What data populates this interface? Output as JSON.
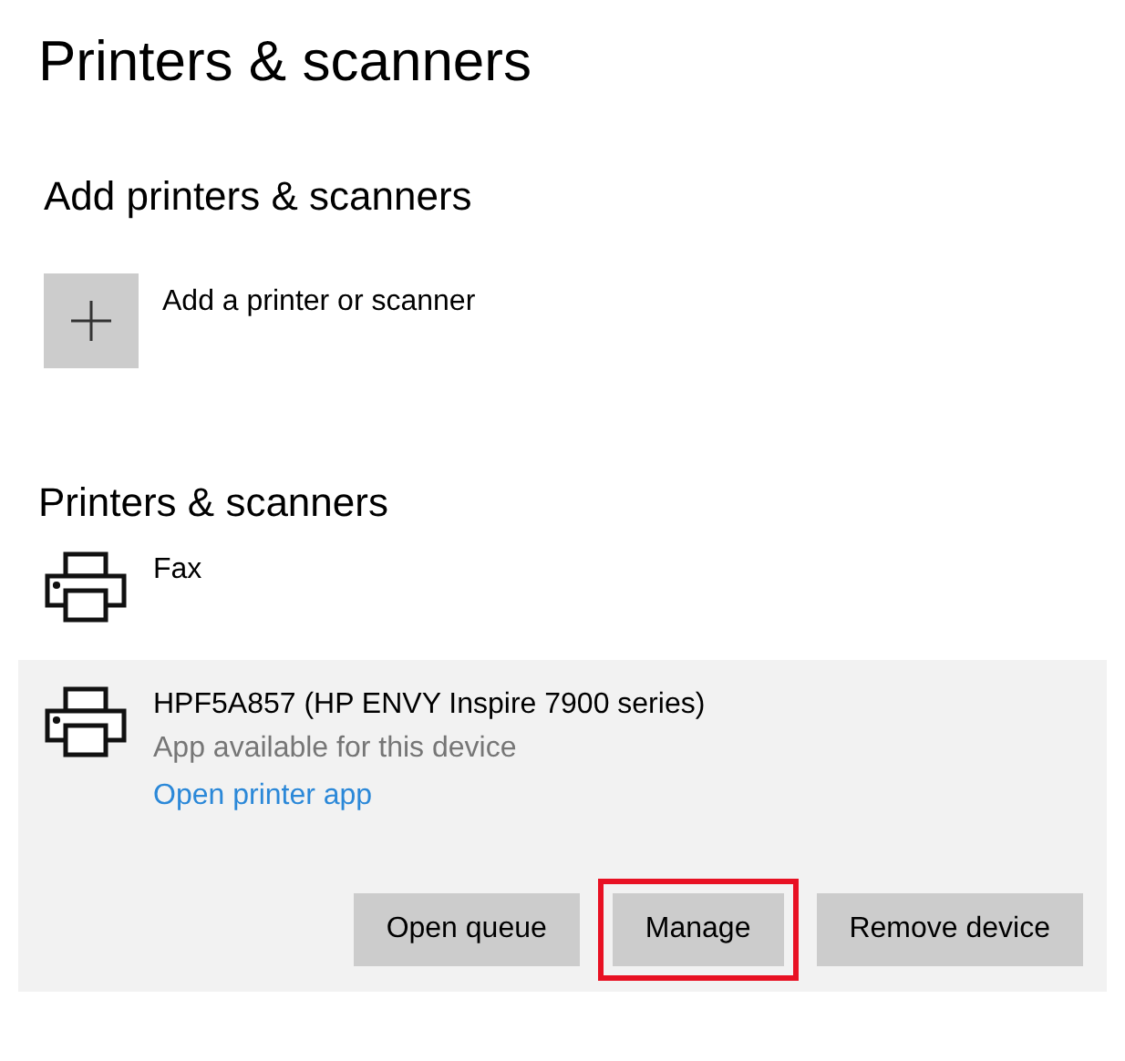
{
  "title": "Printers & scanners",
  "add_section": {
    "heading": "Add printers & scanners",
    "button_label": "Add a printer or scanner"
  },
  "list_section": {
    "heading": "Printers & scanners"
  },
  "devices": [
    {
      "name": "Fax",
      "selected": false
    },
    {
      "name": "HPF5A857 (HP ENVY Inspire 7900 series)",
      "selected": true,
      "status": "App available for this device",
      "link": "Open printer app",
      "buttons": [
        {
          "label": "Open queue",
          "highlighted": false
        },
        {
          "label": "Manage",
          "highlighted": true
        },
        {
          "label": "Remove device",
          "highlighted": false
        }
      ]
    }
  ]
}
